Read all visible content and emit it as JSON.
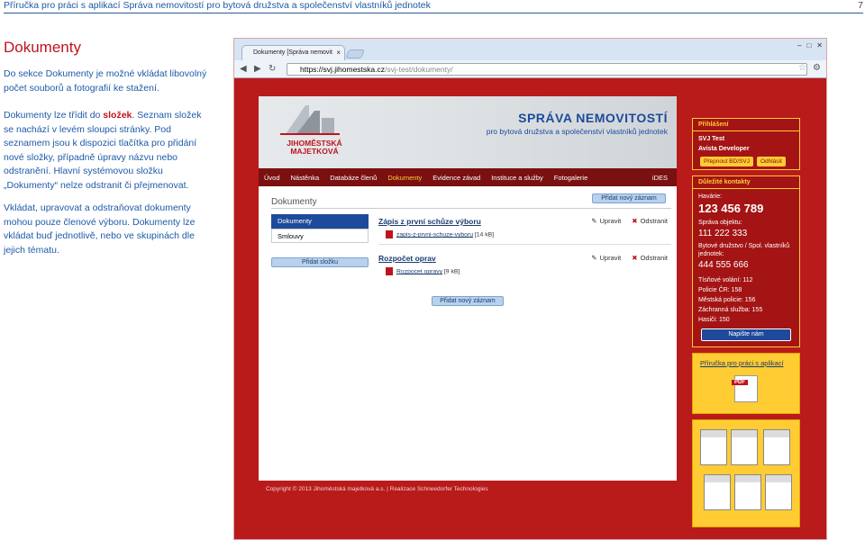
{
  "doc_header": {
    "title": "Příručka pro práci s aplikací Správa nemovitostí pro bytová družstva a společenství vlastníků jednotek",
    "page_number": "7"
  },
  "section": {
    "heading": "Dokumenty",
    "p1": "Do sekce Dokumenty je možné vkládat libovolný počet souborů a fotografií ke stažení.",
    "p2_a": "Dokumenty lze třídit do ",
    "p2_bold": "složek",
    "p2_b": ". Seznam složek se nachází v levém sloupci stránky. Pod seznamem jsou k dispozici tlačítka pro přidání nové složky, případně úpravy názvu nebo odstranění. Hlavní systémovou složku „Dokumenty“ nelze odstranit či přejmenovat.",
    "p3": "Vkládat, upravovat a odstraňovat dokumenty mohou pouze členové výboru. Dokumenty lze vkládat buď jednotlivě, nebo ve skupinách dle jejich tématu."
  },
  "browser": {
    "tab_title": "Dokumenty [Správa nemovit",
    "url_host": "https://svj.jihomestska.cz",
    "url_path": "/svj-test/dokumenty/"
  },
  "site": {
    "logo": "JIHOMĚSTSKÁ MAJETKOVÁ",
    "banner_title": "SPRÁVA NEMOVITOSTÍ",
    "banner_sub": "pro bytová družstva a společenství vlastníků jednotek",
    "nav": [
      "Úvod",
      "Nástěnka",
      "Databáze členů",
      "Dokumenty",
      "Evidence závad",
      "Instituce a služby",
      "Fotogalerie"
    ],
    "nav_active": "Dokumenty",
    "nav_right": "iDES",
    "page_title": "Dokumenty",
    "add_record": "Přidat nový záznam",
    "folders": [
      "Dokumenty",
      "Smlouvy"
    ],
    "add_folder": "Přidat složku",
    "docs": [
      {
        "title": "Zápis z první schůze výboru",
        "file": "zapis-z-prvni-schuze-vyboru",
        "size": "[14 kB]",
        "edit": "Upravit",
        "remove": "Odstranit"
      },
      {
        "title": "Rozpočet oprav",
        "file": "Rozpocet opravy",
        "size": "[9 kB]",
        "edit": "Upravit",
        "remove": "Odstranit"
      }
    ],
    "footer": "Copyright © 2013 Jihoměstská majetková a.s.   |   Realizace Schneedorfer Technologies"
  },
  "sidebar": {
    "login_head": "Přihlášení",
    "svj": "SVJ Test",
    "user": "Avista Developer",
    "switch_btn": "Přepnout BD/SVJ",
    "logout_btn": "Odhlásit",
    "contacts_head": "Důležité kontakty",
    "c1_label": "Havárie:",
    "c1_num": "123 456 789",
    "c2_label": "Správa objektu:",
    "c2_num": "111 222 333",
    "c3_label": "Bytové družstvo / Spol. vlastníků jednotek:",
    "c3_num": "444 555 666",
    "tisnove": "Tísňové volání: 112",
    "policie": "Policie ČR: 158",
    "mestska": "Městská policie: 156",
    "zachranna": "Záchranná služba: 155",
    "hasici": "Hasiči: 150",
    "write_btn": "Napište nám",
    "manual_link": "Příručka pro práci s aplikací",
    "pdf_label": "PDF"
  }
}
